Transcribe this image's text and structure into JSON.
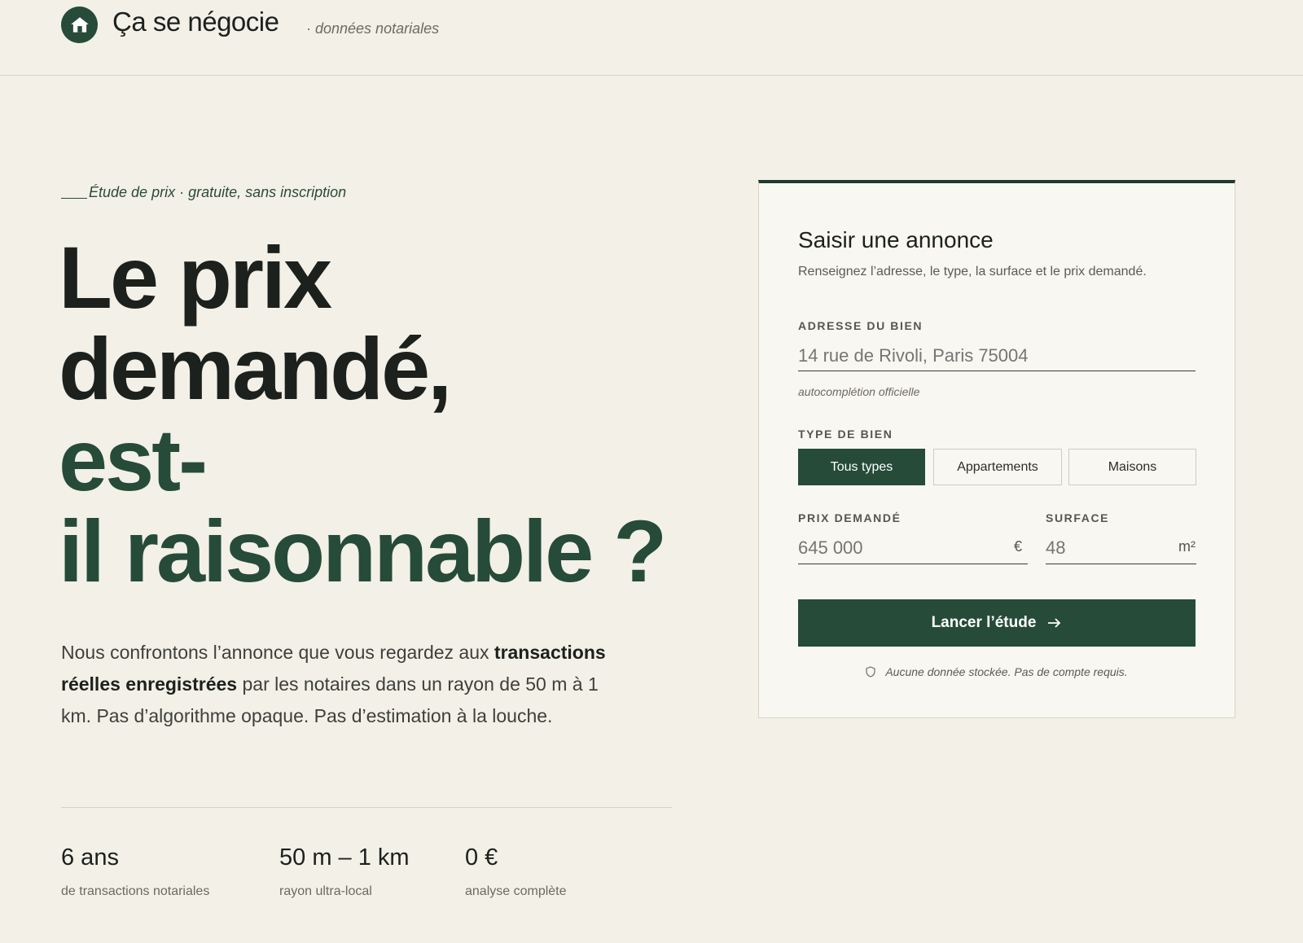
{
  "header": {
    "brand": "Ça se négocie",
    "subtitle": "· données notariales",
    "logo_icon": "home-icon"
  },
  "hero": {
    "eyebrow": "Étude de prix · gratuite, sans inscription",
    "title_line1": "Le prix",
    "title_line2": "demandé,",
    "title_line3": "est-",
    "title_line4": "il raisonnable ?",
    "lead_part1": "Nous confrontons l’annonce que vous regardez aux ",
    "lead_bold": "transactions réelles enregistrées",
    "lead_part2": " par les notaires dans un rayon de 50 m à 1 km. Pas d’algorithme opaque. Pas d’estimation à la louche."
  },
  "stats": [
    {
      "value": "6 ans",
      "label": "de transactions notariales"
    },
    {
      "value": "50 m – 1 km",
      "label": "rayon ultra-local"
    },
    {
      "value": "0 €",
      "label": "analyse complète"
    }
  ],
  "form": {
    "title": "Saisir une annonce",
    "description": "Renseignez l’adresse, le type, la surface et le prix demandé.",
    "address_label": "ADRESSE DU BIEN",
    "address_placeholder": "14 rue de Rivoli, Paris 75004",
    "address_hint": "autocomplétion officielle",
    "type_label": "TYPE DE BIEN",
    "types": [
      "Tous types",
      "Appartements",
      "Maisons"
    ],
    "type_selected": "Tous types",
    "price_label": "PRIX DEMANDÉ",
    "price_placeholder": "645 000",
    "price_unit": "€",
    "surface_label": "SURFACE",
    "surface_placeholder": "48",
    "surface_unit": "m²",
    "submit_label": "Lancer l’étude",
    "footnote": "Aucune donnée stockée. Pas de compte requis."
  },
  "colors": {
    "background": "#f3f0e7",
    "accent": "#264b39",
    "card": "#f9f7f2"
  }
}
